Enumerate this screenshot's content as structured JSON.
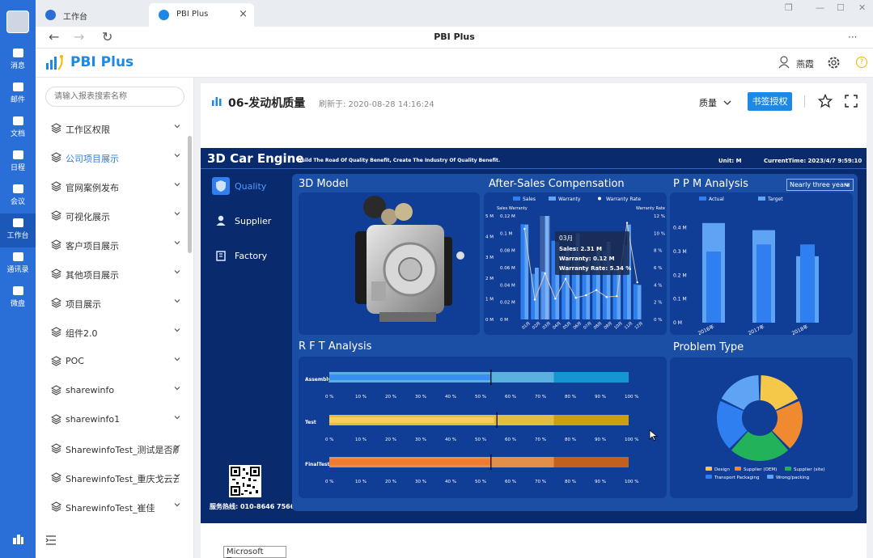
{
  "rail": {
    "items": [
      {
        "label": "消息",
        "icon": "chat-icon"
      },
      {
        "label": "邮件",
        "icon": "mail-icon"
      },
      {
        "label": "文档",
        "icon": "document-icon"
      },
      {
        "label": "日程",
        "icon": "calendar-icon"
      },
      {
        "label": "会议",
        "icon": "meeting-icon"
      },
      {
        "label": "工作台",
        "icon": "grid-icon",
        "active": true
      },
      {
        "label": "通讯录",
        "icon": "contacts-icon"
      },
      {
        "label": "微盘",
        "icon": "drive-icon"
      }
    ]
  },
  "tabs": [
    {
      "label": "工作台"
    },
    {
      "label": "PBI Plus"
    }
  ],
  "window": {
    "title": "PBI Plus",
    "menu_glyph": "···"
  },
  "app": {
    "logo_text": "PBI Plus",
    "user_name": "燕霞",
    "help_glyph": "?"
  },
  "sidebar": {
    "search_placeholder": "请输入报表搜索名称",
    "items": [
      {
        "label": "工作区权限"
      },
      {
        "label": "公司项目展示",
        "active": true
      },
      {
        "label": "官网案例发布"
      },
      {
        "label": "可视化展示"
      },
      {
        "label": "客户项目展示"
      },
      {
        "label": "其他项目展示"
      },
      {
        "label": "项目展示"
      },
      {
        "label": "组件2.0"
      },
      {
        "label": "POC"
      },
      {
        "label": "sharewinfo"
      },
      {
        "label": "sharewinfo1"
      },
      {
        "label": "SharewinfoTest_测试是否刷"
      },
      {
        "label": "SharewinfoTest_重庆戈云云"
      },
      {
        "label": "SharewinfoTest_崔佳"
      }
    ]
  },
  "report": {
    "title": "06-发动机质量",
    "refresh": "刷新于: 2020-08-28 14:16:24",
    "dropdown_label": "质量",
    "bookmark_label": "书签授权"
  },
  "dashboard": {
    "title": "3D Car Engine",
    "subtitle": "Build The Road Of Quality Benefit,  Create The Industry Of Quality Benefit.",
    "unit": "Unit:  M",
    "current_time": "CurrentTime:  2023/4/7 9:59:10",
    "nav": [
      {
        "label": "Quality",
        "active": true
      },
      {
        "label": "Supplier"
      },
      {
        "label": "Factory"
      }
    ],
    "hotline": "服务热线: 010-8646 7566",
    "panels": {
      "model": "3D Model",
      "aftersales": "After-Sales Compensation",
      "ppm": "P P M Analysis",
      "ppm_filter": "Nearly three years",
      "rft": "R F T Analysis",
      "problem": "Problem Type"
    },
    "colors": {
      "bg": "#0a2a6e",
      "panel": "#103d95",
      "bar_blue": "#2f7ff0",
      "bar_light": "#5fa3f5",
      "assembly_main": "#3a8ef0",
      "assembly_light": "#5bb0df",
      "test_main": "#f5cf5a",
      "test_dark": "#c9a012",
      "final_main": "#f07a30",
      "final_dark": "#c2601e"
    }
  },
  "chart_data": [
    {
      "type": "bar",
      "name": "after_sales",
      "legend": [
        "Sales",
        "Warranty",
        "Warranty Rate"
      ],
      "y_left_title": "Sales",
      "y_right_title": "Warranty",
      "y3_title": "Warranty Rate",
      "categories": [
        "01月",
        "02月",
        "03月",
        "04月",
        "05月",
        "06月",
        "07月",
        "08月",
        "09月",
        "10月",
        "11月",
        "12月"
      ],
      "series": [
        {
          "name": "Sales",
          "values": [
            4.6,
            2.2,
            2.31,
            3.8,
            3.2,
            3.5,
            2.6,
            3.0,
            3.3,
            2.4,
            3.6,
            1.7
          ]
        },
        {
          "name": "Warranty",
          "values": [
            0.11,
            0.06,
            0.12,
            0.09,
            0.08,
            0.1,
            0.07,
            0.08,
            0.09,
            0.06,
            0.11,
            0.04
          ]
        },
        {
          "name": "Warranty Rate",
          "values": [
            10.5,
            2.3,
            5.34,
            2.4,
            4.7,
            2.5,
            2.8,
            3.4,
            2.6,
            2.7,
            11.2,
            4.3
          ]
        }
      ],
      "y_left_ticks": [
        "0 M",
        "1 M",
        "2 M",
        "3 M",
        "4 M",
        "5 M"
      ],
      "y_warranty_ticks": [
        "0 M",
        "0.02 M",
        "0.04 M",
        "0.06 M",
        "0.08 M",
        "0.1 M",
        "0.12 M"
      ],
      "y_right_ticks": [
        "0 %",
        "2 %",
        "4 %",
        "6 %",
        "8 %",
        "10 %",
        "12 %"
      ],
      "ylim": [
        0,
        5
      ],
      "y2lim": [
        0,
        12
      ],
      "tooltip": {
        "title": "03月",
        "lines": [
          "Sales:  2.31 M",
          "Warranty:  0.12 M",
          "Warranty Rate:  5.34 %"
        ]
      }
    },
    {
      "type": "bar",
      "name": "ppm",
      "legend": [
        "Actual",
        "Target"
      ],
      "categories": [
        "2016年",
        "2017年",
        "2018年"
      ],
      "series": [
        {
          "name": "Target",
          "values": [
            0.42,
            0.39,
            0.28
          ]
        },
        {
          "name": "Actual",
          "values": [
            0.3,
            0.33,
            0.33
          ]
        }
      ],
      "y_ticks": [
        "0 M",
        "0.1 M",
        "0.2 M",
        "0.3 M",
        "0.4 M"
      ],
      "ylim": [
        0,
        0.45
      ]
    },
    {
      "type": "bar",
      "name": "rft",
      "orientation": "horizontal",
      "categories": [
        "Assembly",
        "Test",
        "FinalTest"
      ],
      "x_ticks": [
        "0 %",
        "10 %",
        "20 %",
        "30 %",
        "40 %",
        "50 %",
        "60 %",
        "70 %",
        "80 %",
        "90 %",
        "100 %"
      ],
      "xlim": [
        0,
        100
      ],
      "bands": [
        {
          "category": "Assembly",
          "actual": 54,
          "marker": 54,
          "mid": 75
        },
        {
          "category": "Test",
          "actual": 55,
          "marker": 56,
          "mid": 75
        },
        {
          "category": "FinalTest",
          "actual": 54,
          "marker": 54,
          "mid": 75
        }
      ]
    },
    {
      "type": "pie",
      "name": "problem_type",
      "donut": true,
      "labels": [
        "Design",
        "Supplier (OEM)",
        "Supplier (site)",
        "Transport Packaging",
        "Wrong/packing"
      ],
      "values": [
        18,
        20,
        24,
        20,
        18
      ],
      "colors": [
        "#f5c84a",
        "#f08a30",
        "#22b35a",
        "#2f7ff0",
        "#5fa3f5"
      ]
    }
  ]
}
